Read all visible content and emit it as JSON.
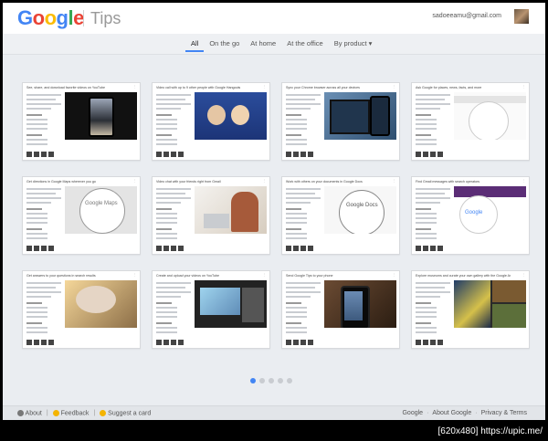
{
  "header": {
    "logo_letters": [
      {
        "ch": "G",
        "color": "#4285f4"
      },
      {
        "ch": "o",
        "color": "#ea4335"
      },
      {
        "ch": "o",
        "color": "#fbbc05"
      },
      {
        "ch": "g",
        "color": "#4285f4"
      },
      {
        "ch": "l",
        "color": "#34a853"
      },
      {
        "ch": "e",
        "color": "#ea4335"
      }
    ],
    "product": "Tips",
    "email": "sadoeeamu@gmail.com"
  },
  "nav": {
    "tabs": [
      {
        "label": "All",
        "active": true
      },
      {
        "label": "On the go",
        "active": false
      },
      {
        "label": "At home",
        "active": false
      },
      {
        "label": "At the office",
        "active": false
      },
      {
        "label": "By product",
        "active": false,
        "dropdown": true
      }
    ]
  },
  "cards": [
    {
      "title": "See, share, and download favorite videos on YouTube",
      "image": "phone"
    },
    {
      "title": "Video call with up to 9 other people with Google Hangouts",
      "image": "video"
    },
    {
      "title": "Sync your Chrome browser across all your devices",
      "image": "tablet"
    },
    {
      "title": "Ask Google for places, news, facts, and more",
      "image": "browser"
    },
    {
      "title": "Get directions in Google Maps wherever you go",
      "image": "maps"
    },
    {
      "title": "Video chat with your friends right from Gmail",
      "image": "woman"
    },
    {
      "title": "Work with others on your documents in Google Docs",
      "image": "gdocs"
    },
    {
      "title": "Find Gmail messages with search operators",
      "image": "gmail"
    },
    {
      "title": "Get answers to your questions in search results",
      "image": "cat"
    },
    {
      "title": "Create and upload your videos on YouTube",
      "image": "yt"
    },
    {
      "title": "Send Google Tips to your phone",
      "image": "hand"
    },
    {
      "title": "Explore museums and curate your own gallery with the Google Art Project",
      "image": "art"
    }
  ],
  "pagination": {
    "count": 5,
    "active_index": 0
  },
  "footer": {
    "left": [
      {
        "label": "About",
        "icon_color": "#777"
      },
      {
        "label": "Feedback",
        "icon_color": "#f4b400"
      },
      {
        "label": "Suggest a card",
        "icon_color": "#f4b400"
      }
    ],
    "right": [
      "Google",
      "About Google",
      "Privacy & Terms"
    ]
  },
  "watermark": "[620x480] https://upic.me/"
}
